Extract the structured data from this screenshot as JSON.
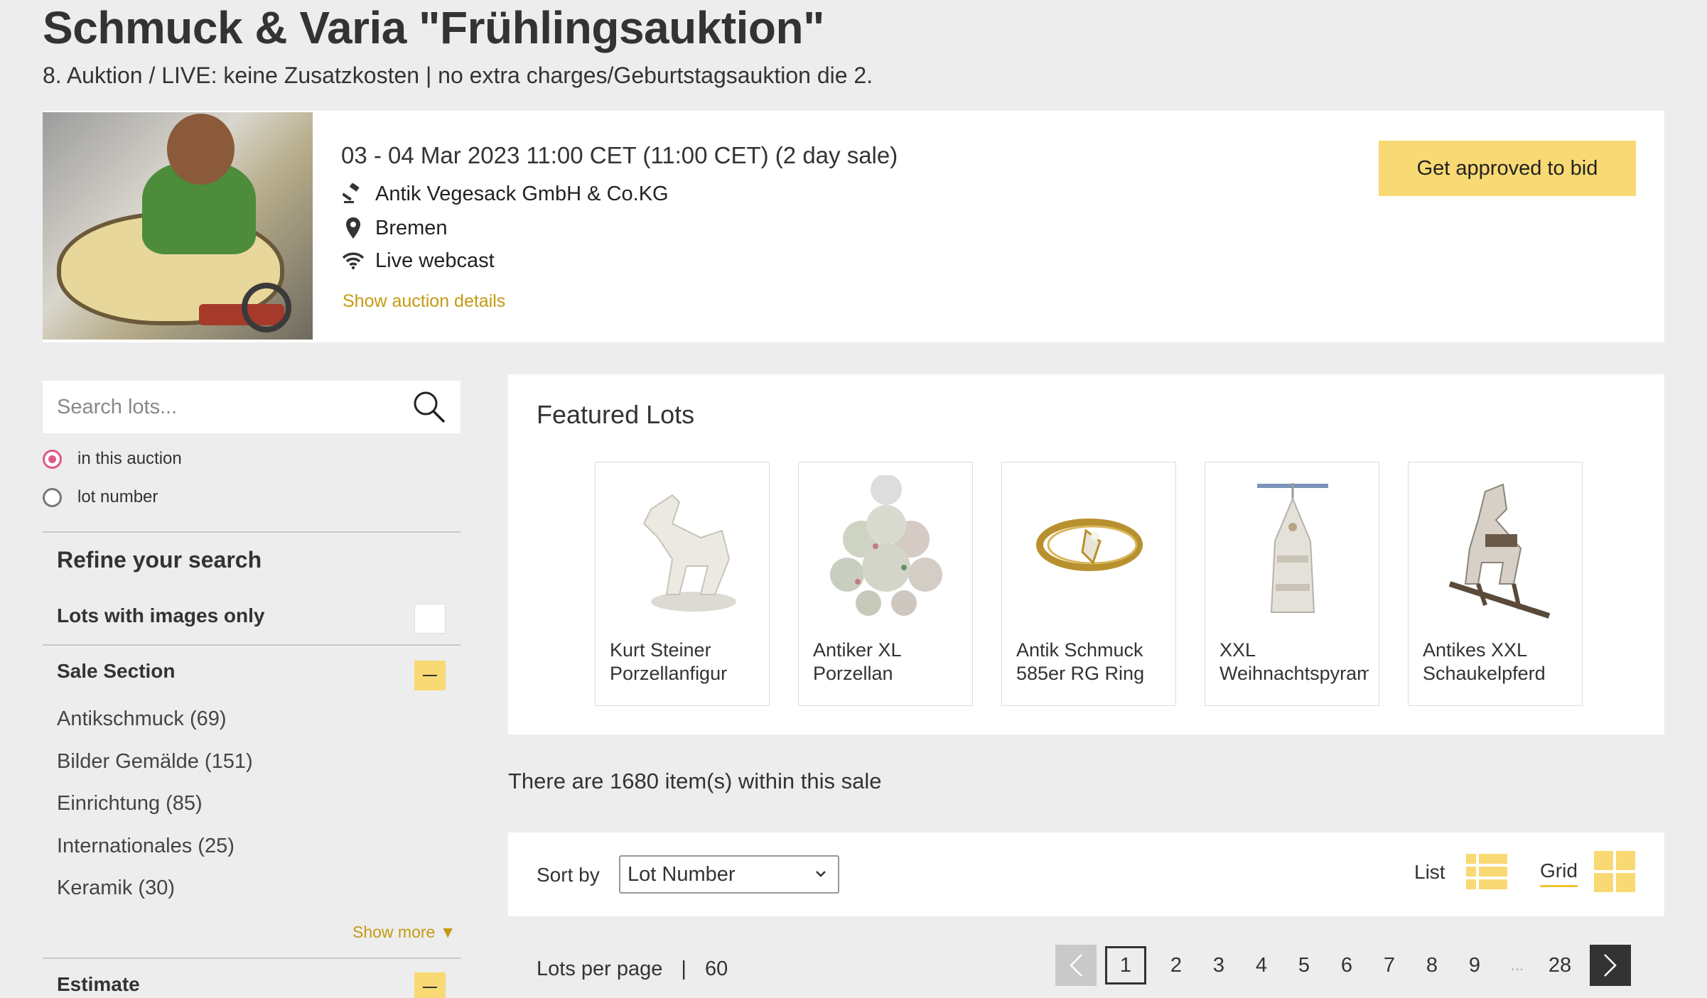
{
  "auction": {
    "title": "Schmuck & Varia \"Frühlingsauktion\"",
    "subtitle": "8. Auktion / LIVE: keine Zusatzkosten | no extra charges/Geburtstagsauktion die 2.",
    "date": "03 - 04 Mar 2023 11:00 CET (11:00 CET) (2 day sale)",
    "house": "Antik Vegesack GmbH & Co.KG",
    "city": "Bremen",
    "webcast": "Live webcast",
    "details_link": "Show auction details",
    "approve_button": "Get approved to bid",
    "icons": {
      "house": "gavel-icon",
      "city": "location-pin-icon",
      "webcast": "wifi-icon"
    }
  },
  "sidebar": {
    "search": {
      "placeholder": "Search lots..."
    },
    "scope_options": [
      {
        "label": "in this auction",
        "checked": true
      },
      {
        "label": "lot number",
        "checked": false
      }
    ],
    "refine_title": "Refine your search",
    "images_only_label": "Lots with images only",
    "sale_section_title": "Sale Section",
    "sale_sections": [
      "Antikschmuck (69)",
      "Bilder Gemälde (151)",
      "Einrichtung (85)",
      "Internationales (25)",
      "Keramik (30)"
    ],
    "show_more": "Show more ▼",
    "estimate_title": "Estimate"
  },
  "featured": {
    "title": "Featured Lots",
    "lots": [
      {
        "caption": "Kurt Steiner Porzellanfigur",
        "icon": "porcelain-horse-figure"
      },
      {
        "caption": "Antiker XL Porzellan Kronleuchter",
        "icon": "porcelain-chandelier"
      },
      {
        "caption": "Antik Schmuck 585er RG Ring",
        "icon": "gold-ring"
      },
      {
        "caption": "XXL Weihnachtspyramide",
        "icon": "christmas-pyramid"
      },
      {
        "caption": "Antikes XXL Schaukelpferd",
        "icon": "rocking-horse"
      }
    ]
  },
  "results": {
    "count_text": "There are 1680 item(s) within this sale",
    "sort_label": "Sort by",
    "sort_value": "Lot Number",
    "view_list_label": "List",
    "view_grid_label": "Grid",
    "lots_per_page_label": "Lots per page",
    "lots_per_page_sep": "|",
    "lots_per_page_value": "60",
    "pagination": {
      "pages": [
        "1",
        "2",
        "3",
        "4",
        "5",
        "6",
        "7",
        "8",
        "9"
      ],
      "current": "1",
      "ellipsis": "...",
      "last": "28"
    }
  },
  "colors": {
    "accent_yellow": "#f8d973",
    "link_gold": "#c49a12",
    "radio_pink": "#e0588a",
    "background": "#ededed"
  }
}
